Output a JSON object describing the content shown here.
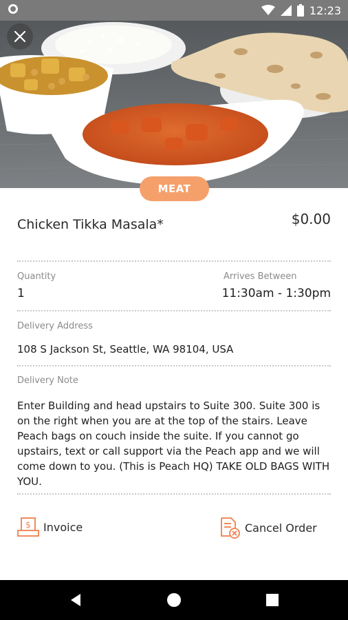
{
  "status_bar": {
    "time": "12:23"
  },
  "hero": {
    "image_desc_icon": "food-photo"
  },
  "tag": {
    "label": "MEAT",
    "color": "#f5a06b"
  },
  "item": {
    "title": "Chicken Tikka Masala*",
    "price": "$0.00"
  },
  "quantity": {
    "label": "Quantity",
    "value": "1"
  },
  "arrives": {
    "label": "Arrives Between",
    "value": "11:30am - 1:30pm"
  },
  "address": {
    "label": "Delivery Address",
    "value": "108 S Jackson St, Seattle, WA 98104, USA"
  },
  "note": {
    "label": "Delivery Note",
    "value": "Enter Building and head upstairs to Suite 300. Suite 300 is on the right when you are at the top of the stairs. Leave Peach bags on couch inside the suite. If you cannot go upstairs, text or call support via the Peach app and we will come down to you. (This is Peach HQ) TAKE OLD BAGS WITH YOU."
  },
  "actions": {
    "invoice_label": "Invoice",
    "cancel_label": "Cancel Order",
    "accent": "#f08a5d"
  }
}
